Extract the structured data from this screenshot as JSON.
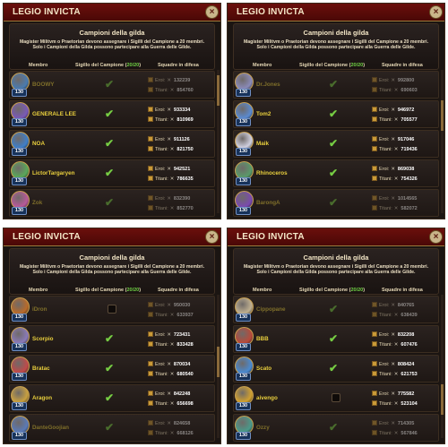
{
  "guild_name": "LEGIO INVICTA",
  "panel_title": "Campioni della gilda",
  "description": "Magister Militvm o Praetorian devono assegnare i Sigilli del Campione a 20 membri. Solo i Campioni della Gilda possono partecipare alla Guerra delle Gilde.",
  "columns": {
    "member": "Membro",
    "seal_prefix": "Sigillo del Campione (",
    "seal_count": "20/20",
    "seal_suffix": ")",
    "defense": "Squadre in difesa"
  },
  "labels": {
    "heroes": "Eroi:",
    "titans": "Titani:",
    "close": "×"
  },
  "colors": {
    "check": "#76cc43",
    "name": "#e9cf3d",
    "header": "#6b0f0c"
  },
  "panels": [
    {
      "rows": [
        {
          "name": "BOOWY",
          "level": "130",
          "seal": true,
          "heroes": "",
          "titans": "854760",
          "hero_text": "132239",
          "avatar": "#4a7bb0"
        },
        {
          "name": "GENERALE LEE",
          "level": "130",
          "seal": true,
          "heroes": "933334",
          "titans": "810969",
          "avatar": "#7a5ab8"
        },
        {
          "name": "NOA",
          "level": "130",
          "seal": true,
          "heroes": "911126",
          "titans": "821750",
          "avatar": "#3f7fc9"
        },
        {
          "name": "LictorTargaryen",
          "level": "130",
          "seal": true,
          "heroes": "942521",
          "titans": "786635",
          "avatar": "#5aa85a"
        },
        {
          "name": "Zok",
          "level": "130",
          "seal": true,
          "heroes": "832390",
          "titans": "852770",
          "avatar": "#b85a9a"
        }
      ]
    },
    {
      "rows": [
        {
          "name": "Dr.Jones",
          "level": "130",
          "seal": true,
          "heroes": "992800",
          "titans": "690603",
          "avatar": "#8a8ab8"
        },
        {
          "name": "Tom2",
          "level": "130",
          "seal": true,
          "heroes": "946972",
          "titans": "705577",
          "avatar": "#5a8ad0"
        },
        {
          "name": "Maik",
          "level": "130",
          "seal": true,
          "heroes": "917046",
          "titans": "719436",
          "avatar": "#d0d0e0"
        },
        {
          "name": "Rhinoceros",
          "level": "130",
          "seal": true,
          "heroes": "869038",
          "titans": "754326",
          "avatar": "#5a9a6a"
        },
        {
          "name": "BarongA",
          "level": "130",
          "seal": true,
          "heroes": "1014565",
          "titans": "582072",
          "avatar": "#7a4ab0"
        }
      ]
    },
    {
      "rows": [
        {
          "name": "iDron",
          "level": "130",
          "seal": false,
          "heroes": "950030",
          "titans": "633937",
          "avatar": "#b86a2a"
        },
        {
          "name": "Scorpio",
          "level": "130",
          "seal": true,
          "heroes": "723431",
          "titans": "833428",
          "avatar": "#8a7ab8"
        },
        {
          "name": "Bratac",
          "level": "130",
          "seal": true,
          "heroes": "870034",
          "titans": "680540",
          "avatar": "#c04a4a"
        },
        {
          "name": "Aragon",
          "level": "130",
          "seal": true,
          "heroes": "842248",
          "titans": "656698",
          "avatar": "#c8a040"
        },
        {
          "name": "DanteGoojian",
          "level": "130",
          "seal": true,
          "heroes": "824658",
          "titans": "668126",
          "avatar": "#5a7ab8"
        }
      ]
    },
    {
      "rows": [
        {
          "name": "Cippopane",
          "level": "130",
          "seal": true,
          "heroes": "840765",
          "titans": "638439",
          "avatar": "#c0b090"
        },
        {
          "name": "BBB",
          "level": "130",
          "seal": true,
          "heroes": "832208",
          "titans": "607476",
          "avatar": "#b84a3a"
        },
        {
          "name": "Scato",
          "level": "130",
          "seal": true,
          "heroes": "808424",
          "titans": "621753",
          "avatar": "#4a8ad0"
        },
        {
          "name": "aivengo",
          "level": "130",
          "seal": false,
          "heroes": "775582",
          "titans": "523104",
          "avatar": "#d0a030"
        },
        {
          "name": "Ozzy",
          "level": "130",
          "seal": true,
          "heroes": "714305",
          "titans": "567846",
          "avatar": "#4a9a8a"
        }
      ]
    }
  ]
}
